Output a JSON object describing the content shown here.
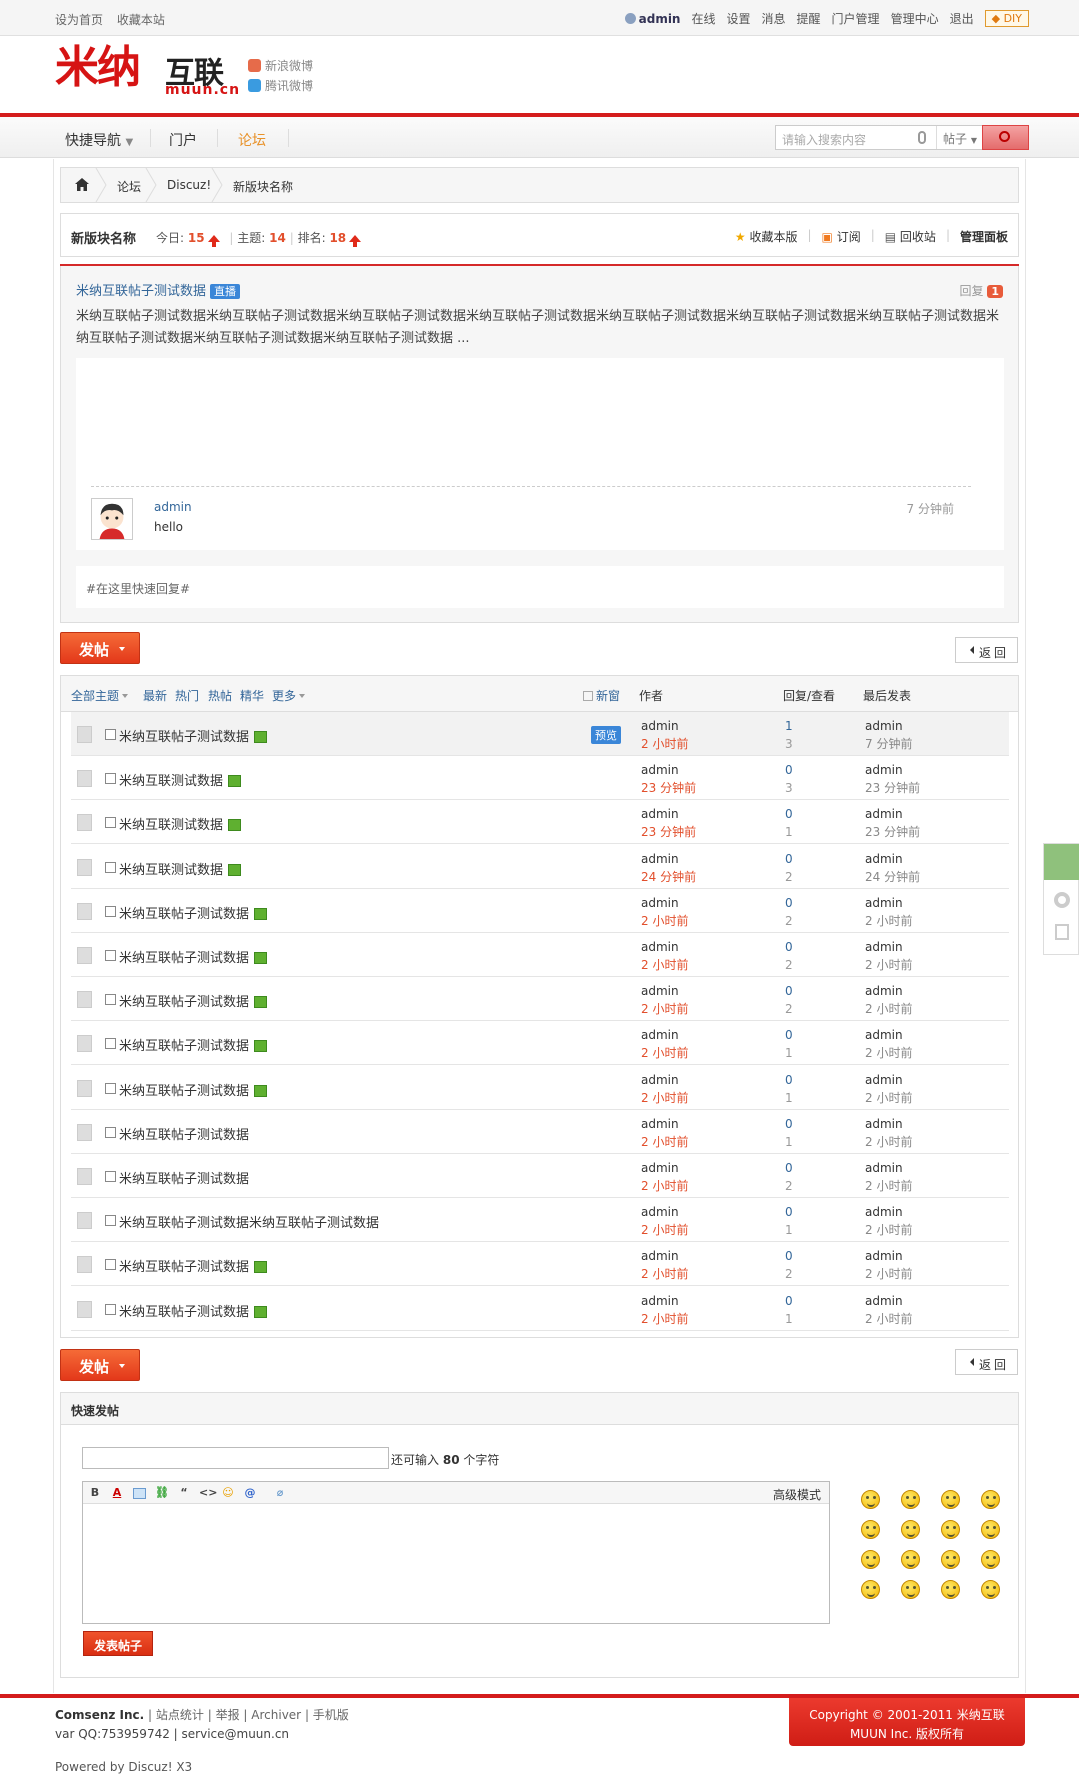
{
  "topbar": {
    "left": [
      "设为首页",
      "收藏本站"
    ],
    "user": "admin",
    "links": [
      "在线",
      "设置",
      "消息",
      "提醒",
      "门户管理",
      "管理中心",
      "退出"
    ],
    "diy": "DIY"
  },
  "logo": {
    "main": "米纳",
    "hanzi": "互联",
    "domain": "muun.cn"
  },
  "weibo": {
    "sina": "新浪微博",
    "tencent": "腾讯微博"
  },
  "nav": {
    "items": [
      "快捷导航",
      "门户",
      "论坛"
    ],
    "active": "论坛"
  },
  "search": {
    "placeholder": "请输入搜索内容",
    "type": "帖子"
  },
  "breadcrumb": [
    "论坛",
    "Discuz!",
    "新版块名称"
  ],
  "forum": {
    "name": "新版块名称",
    "today_label": "今日:",
    "today": "15",
    "threads_label": "主题:",
    "threads": "14",
    "rank_label": "排名:",
    "rank": "18",
    "actions": [
      "收藏本版",
      "订阅",
      "回收站",
      "管理面板"
    ]
  },
  "live": {
    "title": "米纳互联帖子测试数据",
    "badge": "直播",
    "reply_label": "回复",
    "reply_count": "1",
    "body": "米纳互联帖子测试数据米纳互联帖子测试数据米纳互联帖子测试数据米纳互联帖子测试数据米纳互联帖子测试数据米纳互联帖子测试数据米纳互联帖子测试数据米纳互联帖子测试数据米纳互联帖子测试数据米纳互联帖子测试数据 ...",
    "reply_user": "admin",
    "reply_msg": "hello",
    "reply_time": "7 分钟前",
    "quick_reply": "#在这里快速回复#"
  },
  "buttons": {
    "post": "发帖",
    "back": "返回",
    "submit": "发表帖子"
  },
  "list_header": {
    "filters": [
      "全部主题",
      "最新",
      "热门",
      "热帖",
      "精华",
      "更多"
    ],
    "newwin": "新窗",
    "author": "作者",
    "replies": "回复/查看",
    "last": "最后发表"
  },
  "threads": [
    {
      "title": "米纳互联帖子测试数据",
      "attach": true,
      "preview": "预览",
      "author": "admin",
      "time": "2 小时前",
      "replies": "1",
      "views": "3",
      "last_user": "admin",
      "last_time": "7 分钟前"
    },
    {
      "title": "米纳互联测试数据",
      "attach": true,
      "preview": "",
      "author": "admin",
      "time": "23 分钟前",
      "replies": "0",
      "views": "3",
      "last_user": "admin",
      "last_time": "23 分钟前"
    },
    {
      "title": "米纳互联测试数据",
      "attach": true,
      "preview": "",
      "author": "admin",
      "time": "23 分钟前",
      "replies": "0",
      "views": "1",
      "last_user": "admin",
      "last_time": "23 分钟前"
    },
    {
      "title": "米纳互联测试数据",
      "attach": true,
      "preview": "",
      "author": "admin",
      "time": "24 分钟前",
      "replies": "0",
      "views": "2",
      "last_user": "admin",
      "last_time": "24 分钟前"
    },
    {
      "title": "米纳互联帖子测试数据",
      "attach": true,
      "preview": "",
      "author": "admin",
      "time": "2 小时前",
      "replies": "0",
      "views": "2",
      "last_user": "admin",
      "last_time": "2 小时前"
    },
    {
      "title": "米纳互联帖子测试数据",
      "attach": true,
      "preview": "",
      "author": "admin",
      "time": "2 小时前",
      "replies": "0",
      "views": "2",
      "last_user": "admin",
      "last_time": "2 小时前"
    },
    {
      "title": "米纳互联帖子测试数据",
      "attach": true,
      "preview": "",
      "author": "admin",
      "time": "2 小时前",
      "replies": "0",
      "views": "2",
      "last_user": "admin",
      "last_time": "2 小时前"
    },
    {
      "title": "米纳互联帖子测试数据",
      "attach": true,
      "preview": "",
      "author": "admin",
      "time": "2 小时前",
      "replies": "0",
      "views": "1",
      "last_user": "admin",
      "last_time": "2 小时前"
    },
    {
      "title": "米纳互联帖子测试数据",
      "attach": true,
      "preview": "",
      "author": "admin",
      "time": "2 小时前",
      "replies": "0",
      "views": "1",
      "last_user": "admin",
      "last_time": "2 小时前"
    },
    {
      "title": "米纳互联帖子测试数据",
      "attach": false,
      "preview": "",
      "author": "admin",
      "time": "2 小时前",
      "replies": "0",
      "views": "1",
      "last_user": "admin",
      "last_time": "2 小时前"
    },
    {
      "title": "米纳互联帖子测试数据",
      "attach": false,
      "preview": "",
      "author": "admin",
      "time": "2 小时前",
      "replies": "0",
      "views": "2",
      "last_user": "admin",
      "last_time": "2 小时前"
    },
    {
      "title": "米纳互联帖子测试数据米纳互联帖子测试数据",
      "attach": false,
      "preview": "",
      "author": "admin",
      "time": "2 小时前",
      "replies": "0",
      "views": "1",
      "last_user": "admin",
      "last_time": "2 小时前"
    },
    {
      "title": "米纳互联帖子测试数据",
      "attach": true,
      "preview": "",
      "author": "admin",
      "time": "2 小时前",
      "replies": "0",
      "views": "2",
      "last_user": "admin",
      "last_time": "2 小时前"
    },
    {
      "title": "米纳互联帖子测试数据",
      "attach": true,
      "preview": "",
      "author": "admin",
      "time": "2 小时前",
      "replies": "0",
      "views": "1",
      "last_user": "admin",
      "last_time": "2 小时前"
    }
  ],
  "quickpost": {
    "title": "快速发帖",
    "remain_pre": "还可输入",
    "remain_num": "80",
    "remain_post": "个字符",
    "advanced": "高级模式",
    "toolbar": [
      "B",
      "A",
      "img",
      "link",
      "“",
      "<>",
      "☺",
      "@",
      "attach"
    ]
  },
  "footer": {
    "company": "Comsenz Inc.",
    "links": [
      "站点统计",
      "举报",
      "Archiver",
      "手机版"
    ],
    "contact": "var QQ:753959742 | service@muun.cn",
    "powered": "Powered by Discuz! X3",
    "copyright1": "Copyright © 2001-2011 米纳互联",
    "copyright2": "MUUN Inc. 版权所有"
  },
  "colors": {
    "brand_red": "#d41c1c",
    "link_blue": "#336699",
    "highlight": "#e24f2c"
  }
}
